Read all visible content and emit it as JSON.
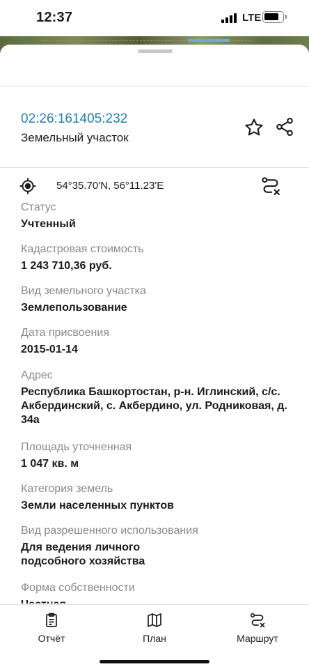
{
  "status_bar": {
    "time": "12:37",
    "network": "LTE"
  },
  "header": {
    "cadastral_number": "02:26:161405:232",
    "object_type": "Земельный участок"
  },
  "location": {
    "coordinates": "54°35.70'N, 56°11.23'E"
  },
  "properties": [
    {
      "label": "Статус",
      "value": "Учтенный"
    },
    {
      "label": "Кадастровая стоимость",
      "value": "1 243 710,36 руб."
    },
    {
      "label": "Вид земельного участка",
      "value": "Землепользование"
    },
    {
      "label": "Дата присвоения",
      "value": "2015-01-14"
    },
    {
      "label": "Адрес",
      "value": "Республика Башкортостан, р-н. Иглинский, с/с. Акбердинский, с. Акбердино, ул. Родниковая, д. 34а"
    },
    {
      "label": "Площадь уточненная",
      "value": "1 047 кв. м"
    },
    {
      "label": "Категория земель",
      "value": "Земли населенных пунктов"
    },
    {
      "label": "Вид разрешенного использования",
      "value": "Для ведения личного подсобного хозяйства"
    },
    {
      "label": "Форма собственности",
      "value": "Частная"
    }
  ],
  "tabbar": {
    "report_label": "Отчёт",
    "plan_label": "План",
    "route_label": "Маршрут"
  },
  "colors": {
    "accent": "#1f7fb8",
    "label_gray": "#8a8a8e",
    "text": "#1c1c1e"
  },
  "icons": [
    "star-icon",
    "share-icon",
    "gps-icon",
    "route-off-icon",
    "clipboard-icon",
    "map-icon",
    "route-icon"
  ]
}
